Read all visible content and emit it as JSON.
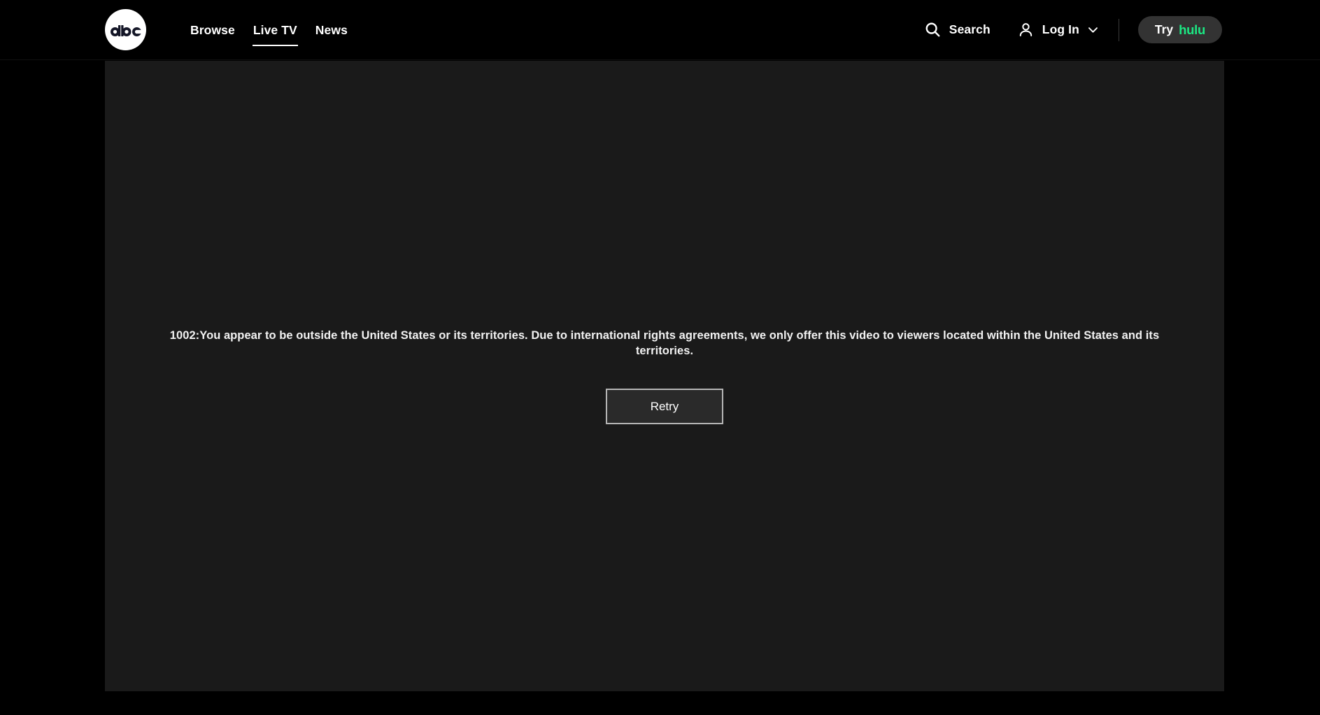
{
  "header": {
    "logo": {
      "name": "abc-logo",
      "alt": "abc"
    },
    "nav_items": [
      {
        "label": "Browse",
        "active": false
      },
      {
        "label": "Live TV",
        "active": true
      },
      {
        "label": "News",
        "active": false
      }
    ],
    "search": {
      "icon": "search-icon",
      "label": "Search"
    },
    "account": {
      "icon": "user-icon",
      "label": "Log In",
      "chevron": "chevron-down-icon"
    },
    "cta": {
      "try_label": "Try",
      "brand_label": "hulu",
      "brand_color": "#1CE783",
      "background": "#333333"
    }
  },
  "player": {
    "background": "#1a1a1a",
    "error": {
      "code": "1002",
      "message": "1002:You appear to be outside the United States or its territories. Due to international rights agreements, we only offer this video to viewers located within the United States and its territories.",
      "retry_label": "Retry"
    }
  },
  "page": {
    "background": "#000000"
  }
}
